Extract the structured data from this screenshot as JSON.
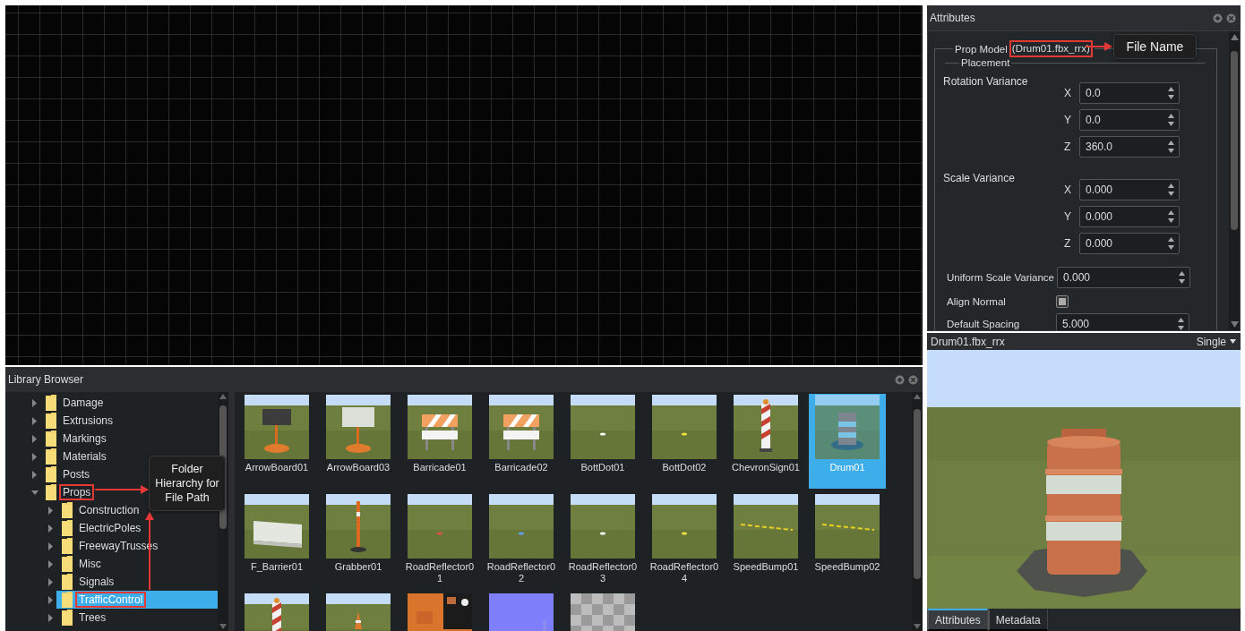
{
  "library_browser": {
    "title": "Library Browser",
    "tree": [
      {
        "label": "Damage",
        "expanded": false,
        "selected": false,
        "highlighted": false
      },
      {
        "label": "Extrusions",
        "expanded": false,
        "selected": false,
        "highlighted": false
      },
      {
        "label": "Markings",
        "expanded": false,
        "selected": false,
        "highlighted": false
      },
      {
        "label": "Materials",
        "expanded": false,
        "selected": false,
        "highlighted": false
      },
      {
        "label": "Posts",
        "expanded": false,
        "selected": false,
        "highlighted": false
      },
      {
        "label": "Props",
        "expanded": true,
        "selected": false,
        "highlighted": true,
        "children": [
          {
            "label": "Construction",
            "expanded": false,
            "selected": false,
            "highlighted": false
          },
          {
            "label": "ElectricPoles",
            "expanded": false,
            "selected": false,
            "highlighted": false
          },
          {
            "label": "FreewayTrusses",
            "expanded": false,
            "selected": false,
            "highlighted": false
          },
          {
            "label": "Misc",
            "expanded": false,
            "selected": false,
            "highlighted": false
          },
          {
            "label": "Signals",
            "expanded": false,
            "selected": false,
            "highlighted": false
          },
          {
            "label": "TrafficControl",
            "expanded": false,
            "selected": true,
            "highlighted": true
          },
          {
            "label": "Trees",
            "expanded": false,
            "selected": false,
            "highlighted": false
          }
        ]
      }
    ],
    "thumbnails": [
      {
        "label": "ArrowBoard01",
        "selected": false
      },
      {
        "label": "ArrowBoard03",
        "selected": false
      },
      {
        "label": "Barricade01",
        "selected": false
      },
      {
        "label": "Barricade02",
        "selected": false
      },
      {
        "label": "BottDot01",
        "selected": false
      },
      {
        "label": "BottDot02",
        "selected": false
      },
      {
        "label": "ChevronSign01",
        "selected": false
      },
      {
        "label": "Drum01",
        "selected": true
      },
      {
        "label": "F_Barrier01",
        "selected": false
      },
      {
        "label": "Grabber01",
        "selected": false
      },
      {
        "label": "RoadReflector01",
        "selected": false
      },
      {
        "label": "RoadReflector02",
        "selected": false
      },
      {
        "label": "RoadReflector03",
        "selected": false
      },
      {
        "label": "RoadReflector04",
        "selected": false
      },
      {
        "label": "SpeedBump01",
        "selected": false
      },
      {
        "label": "SpeedBump02",
        "selected": false
      },
      {
        "selected": false
      },
      {
        "selected": false
      },
      {
        "selected": false
      },
      {
        "selected": false
      },
      {
        "selected": false
      }
    ]
  },
  "attributes": {
    "title": "Attributes",
    "prop_model_label": "Prop Model",
    "file_name": {
      "text": "(Drum01.fbx_rrx)",
      "highlighted": true
    },
    "placement": {
      "title": "Placement",
      "groups": [
        {
          "label": "Rotation Variance",
          "axes": [
            {
              "axis": "X",
              "value": "0.0"
            },
            {
              "axis": "Y",
              "value": "0.0"
            },
            {
              "axis": "Z",
              "value": "360.0"
            }
          ]
        },
        {
          "label": "Scale Variance",
          "axes": [
            {
              "axis": "X",
              "value": "0.000"
            },
            {
              "axis": "Y",
              "value": "0.000"
            },
            {
              "axis": "Z",
              "value": "0.000"
            }
          ]
        }
      ],
      "uniform_scale_variance": {
        "label": "Uniform Scale Variance",
        "value": "0.000"
      },
      "align_normal": {
        "label": "Align Normal",
        "checked": true
      },
      "default_spacing": {
        "label": "Default Spacing",
        "value": "5.000"
      }
    }
  },
  "preview": {
    "title": "Drum01.fbx_rrx",
    "mode": "Single",
    "tabs": [
      {
        "label": "Attributes",
        "selected": true
      },
      {
        "label": "Metadata",
        "selected": false
      }
    ]
  },
  "annotations": [
    {
      "text": "File Name"
    },
    {
      "text": "Folder Hierarchy for File Path"
    }
  ]
}
